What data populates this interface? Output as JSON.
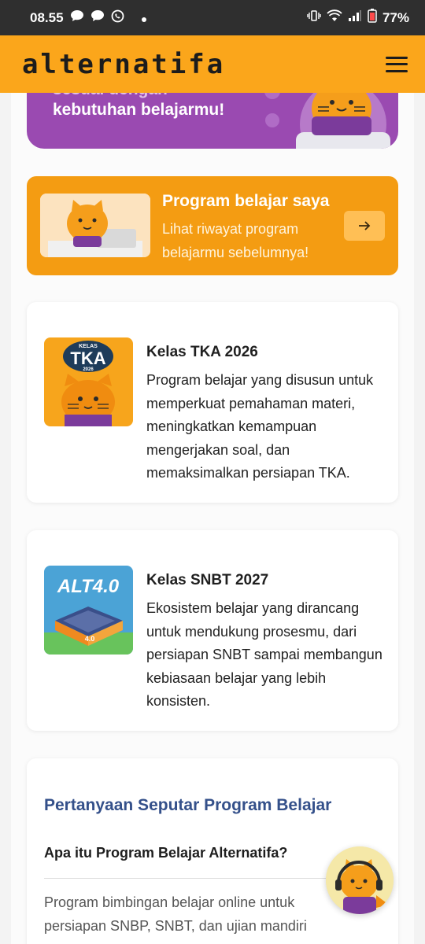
{
  "status_bar": {
    "time": "08.55",
    "battery": "77%"
  },
  "header": {
    "logo": "alternatifa"
  },
  "promo": {
    "line1": "sesuai dengan",
    "line2": "kebutuhan belajarmu!"
  },
  "program_card": {
    "title": "Program belajar saya",
    "subtitle": "Lihat riwayat program belajarmu sebelumnya!"
  },
  "classes": [
    {
      "title": "Kelas TKA 2026",
      "description": "Program belajar yang disusun untuk memperkuat pemahaman materi, meningkatkan kemampuan mengerjakan soal, dan memaksimalkan persiapan TKA.",
      "thumb_badge_top": "KELAS",
      "thumb_badge_main": "TKA",
      "thumb_badge_year": "2026"
    },
    {
      "title": "Kelas SNBT 2027",
      "description": "Ekosistem belajar yang dirancang untuk mendukung prosesmu, dari persiapan SNBT sampai membangun kebiasaan belajar yang lebih konsisten.",
      "thumb_badge_main": "ALT4.0",
      "thumb_badge_sub": "4.0"
    }
  ],
  "faq": {
    "heading": "Pertanyaan Seputar Program Belajar",
    "question": "Apa itu Program Belajar Alternatifa?",
    "answer": "Program bimbingan belajar online untuk persiapan SNBP, SNBT, dan ujian mandiri"
  },
  "colors": {
    "brand_orange": "#fba61b",
    "promo_purple": "#9a4ab1",
    "faq_heading_blue": "#34508a"
  }
}
